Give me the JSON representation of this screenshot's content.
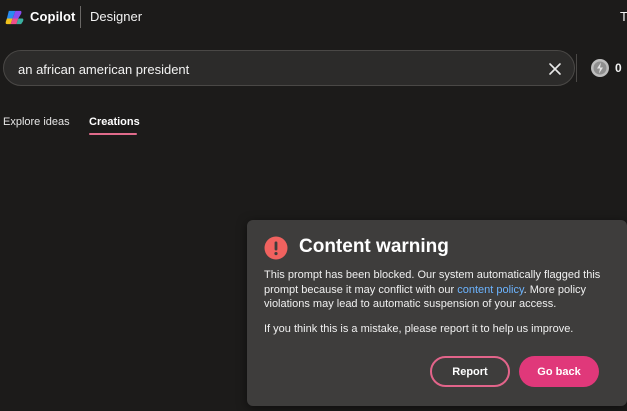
{
  "header": {
    "brand": "Copilot",
    "product": "Designer",
    "corner_text": "T"
  },
  "search": {
    "value": "an african american president",
    "boost_count": "0"
  },
  "tabs": [
    {
      "label": "Explore ideas",
      "active": false
    },
    {
      "label": "Creations",
      "active": true
    }
  ],
  "dialog": {
    "title": "Content warning",
    "body_before_link": "This prompt has been blocked. Our system automatically flagged this prompt because it may conflict with our ",
    "link_text": "content policy",
    "body_after_link": ". More policy violations may lead to automatic suspension of your access.",
    "body2": "If you think this is a mistake, please report it to help us improve.",
    "report_label": "Report",
    "back_label": "Go back"
  },
  "colors": {
    "background": "#1c1b1a",
    "dialog_bg": "#3e3d3c",
    "accent_pink": "#e0387a",
    "warning_red": "#f0625f",
    "link_blue": "#6cb4ff"
  },
  "icons": {
    "logo": "copilot-logo-icon",
    "clear": "close-icon",
    "boost": "boost-coin-icon",
    "warning": "exclamation-circle-icon"
  }
}
